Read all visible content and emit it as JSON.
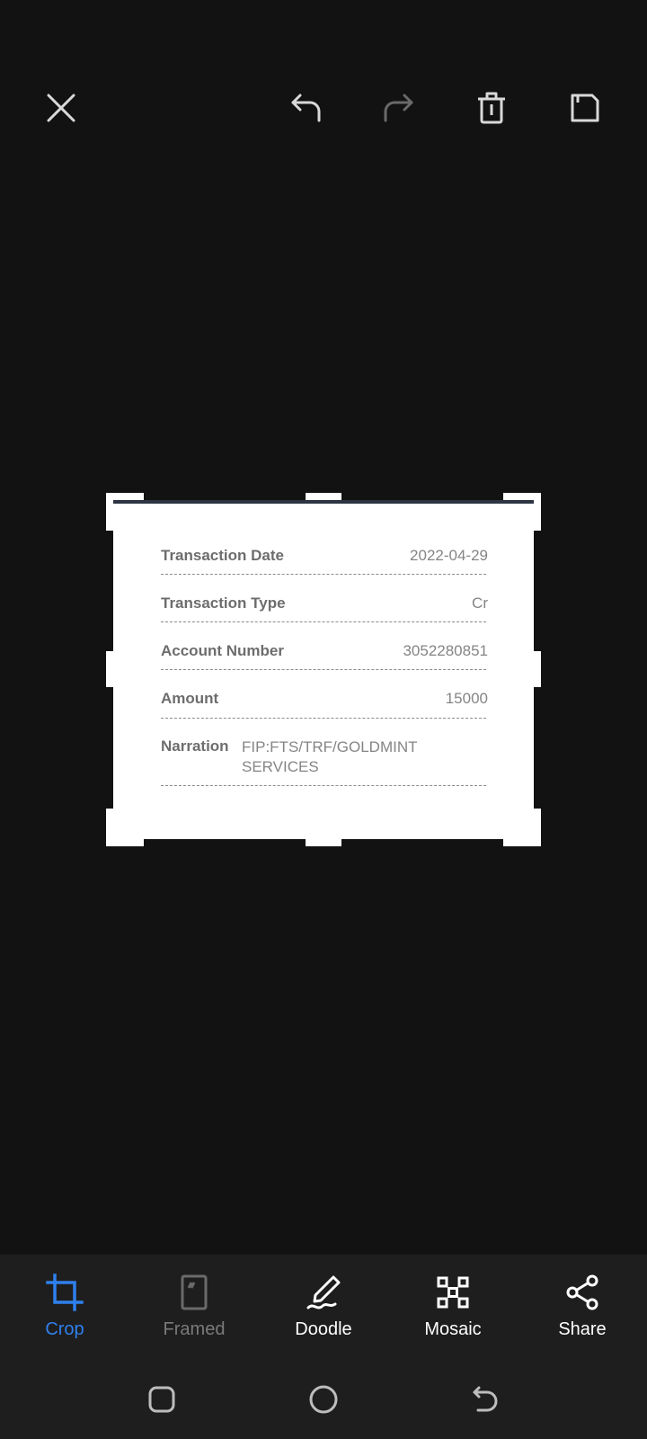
{
  "colors": {
    "background": "#121212",
    "toolbar_background": "#1e1e1e",
    "accent": "#2f80ed",
    "icon_active": "#d9d9d9",
    "icon_disabled": "#6a6a6a",
    "tool_disabled": "#7a7a7a"
  },
  "top_bar": {
    "icons": [
      "close-icon",
      "undo-icon",
      "redo-icon",
      "delete-icon",
      "save-icon"
    ],
    "redo_enabled": false
  },
  "receipt": {
    "rows": [
      {
        "label": "Transaction Date",
        "value": "2022-04-29"
      },
      {
        "label": "Transaction Type",
        "value": "Cr"
      },
      {
        "label": "Account Number",
        "value": "3052280851"
      },
      {
        "label": "Amount",
        "value": "15000"
      },
      {
        "label": "Narration",
        "value": "FIP:FTS/TRF/GOLDMINT SERVICES"
      }
    ]
  },
  "tools": [
    {
      "label": "Crop",
      "icon": "crop-icon",
      "state": "selected"
    },
    {
      "label": "Framed",
      "icon": "frame-icon",
      "state": "disabled"
    },
    {
      "label": "Doodle",
      "icon": "doodle-icon",
      "state": "normal"
    },
    {
      "label": "Mosaic",
      "icon": "mosaic-icon",
      "state": "normal"
    },
    {
      "label": "Share",
      "icon": "share-icon",
      "state": "normal"
    }
  ],
  "nav": {
    "icons": [
      "recents-icon",
      "home-icon",
      "back-icon"
    ]
  }
}
